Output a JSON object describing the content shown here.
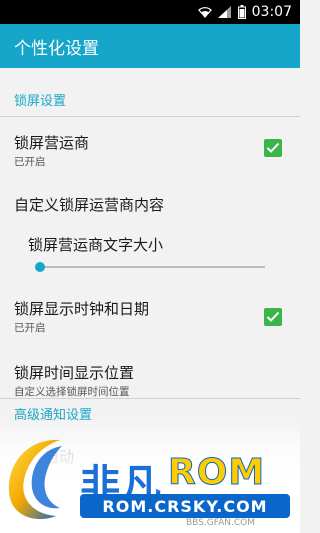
{
  "status_bar": {
    "time": "03:07",
    "wifi_icon": "wifi-icon",
    "signal_icon": "signal-icon",
    "battery_icon": "battery-icon"
  },
  "app_bar": {
    "title": "个性化设置"
  },
  "sections": [
    {
      "header": "锁屏设置"
    },
    {
      "header": "高级通知设置"
    }
  ],
  "settings": [
    {
      "title": "锁屏营运商",
      "summary": "已开启",
      "checked": true
    },
    {
      "title": "自定义锁屏运营商内容"
    },
    {
      "title": "锁屏营运商文字大小",
      "value": 0.0
    },
    {
      "title": "锁屏显示时钟和日期",
      "summary": "已开启",
      "checked": true
    },
    {
      "title": "锁屏时间显示位置",
      "summary": "自定义选择锁屏时间位置"
    },
    {
      "title": "自动"
    }
  ],
  "watermark": {
    "brand": "非凡",
    "rom": "ROM",
    "url": "ROM.CRSKY.COM",
    "bbs": "BBS.GFAN.COM"
  },
  "colors": {
    "accent": "#16a6c9",
    "check": "#3bb54a",
    "watermark_blue": "#0b66c9",
    "watermark_yellow": "#ffcc00"
  }
}
